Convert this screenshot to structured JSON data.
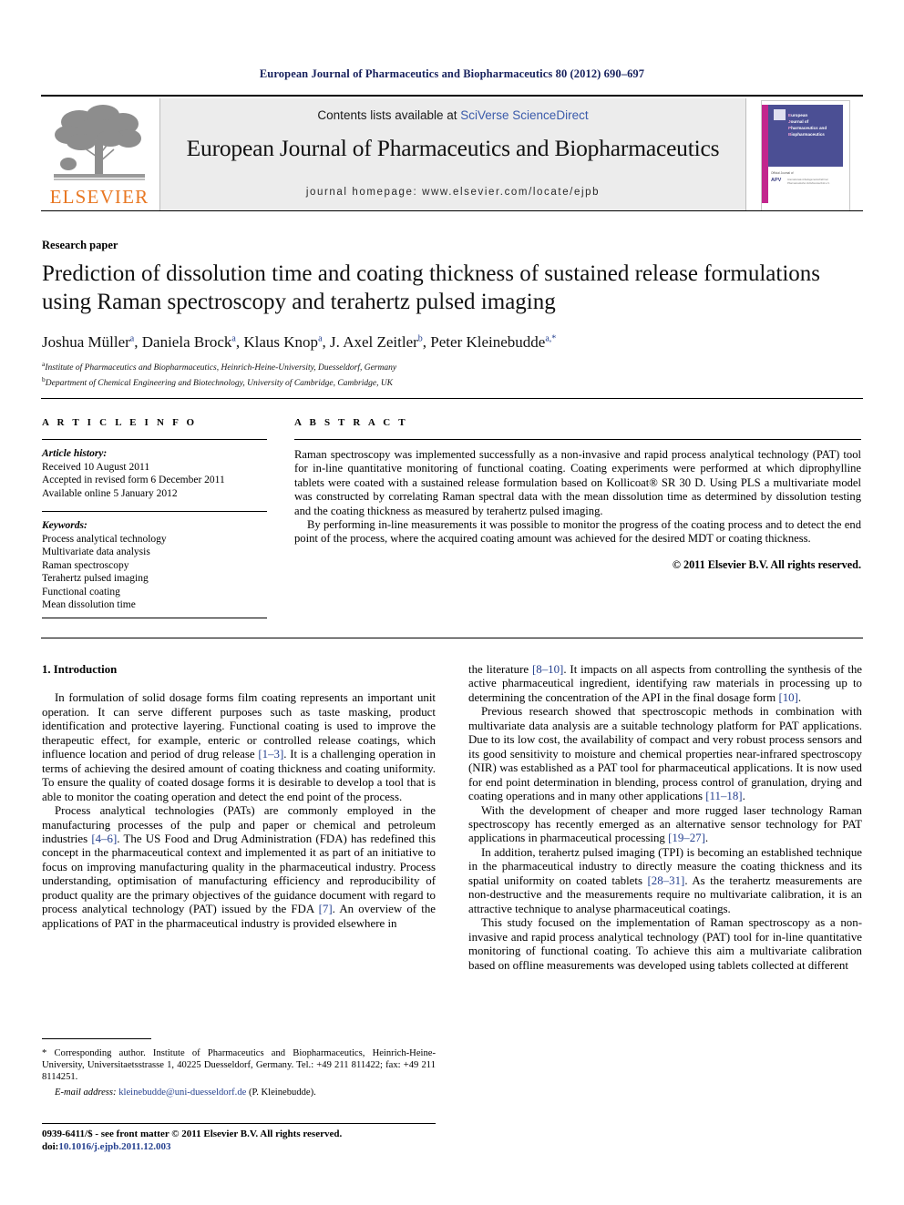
{
  "running_head": "European Journal of Pharmaceutics and Biopharmaceutics 80 (2012) 690–697",
  "masthead": {
    "contents_prefix": "Contents lists available at ",
    "sciencedirect": "SciVerse ScienceDirect",
    "journal_title": "European Journal of Pharmaceutics and Biopharmaceutics",
    "homepage": "journal homepage: www.elsevier.com/locate/ejpb",
    "publisher_word": "ELSEVIER",
    "cover": {
      "line1": "uropean",
      "line2": "ournal of",
      "line3": "harmaceutics and",
      "line4": "iopharmaceutics",
      "cap1": "E",
      "cap2": "J",
      "cap3": "P",
      "cap4": "B",
      "footer_small": "Official Journal of",
      "footer_brand": "APV",
      "footer_tagline": "Internationale Arbeitsgemeinschaft fuer Pharmazeutische Verfahrenstechnik e.V."
    },
    "colors": {
      "elsevier_orange": "#e87722",
      "link_blue": "#3b5bab",
      "banner_grey": "#ececec",
      "cover_navy": "#4b4f94",
      "cover_magenta": "#c2268d"
    }
  },
  "article": {
    "type": "Research paper",
    "title": "Prediction of dissolution time and coating thickness of sustained release formulations using Raman spectroscopy and terahertz pulsed imaging",
    "authors_html": "Joshua Müller<sup>a</sup>, Daniela Brock<sup>a</sup>, Klaus Knop<sup>a</sup>, J. Axel Zeitler<sup>b</sup>, Peter Kleinebudde<sup>a,*</sup>",
    "affiliation_a": "Institute of Pharmaceutics and Biopharmaceutics, Heinrich-Heine-University, Duesseldorf, Germany",
    "affiliation_b": "Department of Chemical Engineering and Biotechnology, University of Cambridge, Cambridge, UK",
    "affiliation_a_marker": "a",
    "affiliation_b_marker": "b"
  },
  "article_info": {
    "label": "A R T I C L E    I N F O",
    "history_head": "Article history:",
    "history": [
      "Received 10 August 2011",
      "Accepted in revised form 6 December 2011",
      "Available online 5 January 2012"
    ],
    "keywords_head": "Keywords:",
    "keywords": [
      "Process analytical technology",
      "Multivariate data analysis",
      "Raman spectroscopy",
      "Terahertz pulsed imaging",
      "Functional coating",
      "Mean dissolution time"
    ]
  },
  "abstract": {
    "label": "A B S T R A C T",
    "paragraph1": "Raman spectroscopy was implemented successfully as a non-invasive and rapid process analytical technology (PAT) tool for in-line quantitative monitoring of functional coating. Coating experiments were performed at which diprophylline tablets were coated with a sustained release formulation based on Kollicoat® SR 30 D. Using PLS a multivariate model was constructed by correlating Raman spectral data with the mean dissolution time as determined by dissolution testing and the coating thickness as measured by terahertz pulsed imaging.",
    "paragraph2": "By performing in-line measurements it was possible to monitor the progress of the coating process and to detect the end point of the process, where the acquired coating amount was achieved for the desired MDT or coating thickness.",
    "copyright": "© 2011 Elsevier B.V. All rights reserved."
  },
  "body": {
    "section_heading": "1. Introduction",
    "left_col": [
      {
        "indent": true,
        "parts": [
          {
            "t": "In formulation of solid dosage forms film coating represents an important unit operation. It can serve different purposes such as taste masking, product identification and protective layering. Functional coating is used to improve the therapeutic effect, for example, enteric or controlled release coatings, which influence location and period of drug release "
          },
          {
            "t": "[1–3]",
            "ref": true
          },
          {
            "t": ". It is a challenging operation in terms of achieving the desired amount of coating thickness and coating uniformity. To ensure the quality of coated dosage forms it is desirable to develop a tool that is able to monitor the coating operation and detect the end point of the process."
          }
        ]
      },
      {
        "indent": true,
        "parts": [
          {
            "t": "Process analytical technologies (PATs) are commonly employed in the manufacturing processes of the pulp and paper or chemical and petroleum industries "
          },
          {
            "t": "[4–6]",
            "ref": true
          },
          {
            "t": ". The US Food and Drug Administration (FDA) has redefined this concept in the pharmaceutical context and implemented it as part of an initiative to focus on improving manufacturing quality in the pharmaceutical industry. Process understanding, optimisation of manufacturing efficiency and reproducibility of product quality are the primary objectives of the guidance document with regard to process analytical technology (PAT) issued by the FDA "
          },
          {
            "t": "[7]",
            "ref": true
          },
          {
            "t": ". An overview of the applications of PAT in the pharmaceutical industry is provided elsewhere in"
          }
        ]
      }
    ],
    "right_col": [
      {
        "indent": false,
        "parts": [
          {
            "t": "the literature "
          },
          {
            "t": "[8–10]",
            "ref": true
          },
          {
            "t": ". It impacts on all aspects from controlling the synthesis of the active pharmaceutical ingredient, identifying raw materials in processing up to determining the concentration of the API in the final dosage form "
          },
          {
            "t": "[10]",
            "ref": true
          },
          {
            "t": "."
          }
        ]
      },
      {
        "indent": true,
        "parts": [
          {
            "t": "Previous research showed that spectroscopic methods in combination with multivariate data analysis are a suitable technology platform for PAT applications. Due to its low cost, the availability of compact and very robust process sensors and its good sensitivity to moisture and chemical properties near-infrared spectroscopy (NIR) was established as a PAT tool for pharmaceutical applications. It is now used for end point determination in blending, process control of granulation, drying and coating operations and in many other applications "
          },
          {
            "t": "[11–18]",
            "ref": true
          },
          {
            "t": "."
          }
        ]
      },
      {
        "indent": true,
        "parts": [
          {
            "t": "With the development of cheaper and more rugged laser technology Raman spectroscopy has recently emerged as an alternative sensor technology for PAT applications in pharmaceutical processing "
          },
          {
            "t": "[19–27]",
            "ref": true
          },
          {
            "t": "."
          }
        ]
      },
      {
        "indent": true,
        "parts": [
          {
            "t": "In addition, terahertz pulsed imaging (TPI) is becoming an established technique in the pharmaceutical industry to directly measure the coating thickness and its spatial uniformity on coated tablets "
          },
          {
            "t": "[28–31]",
            "ref": true
          },
          {
            "t": ". As the terahertz measurements are non-destructive and the measurements require no multivariate calibration, it is an attractive technique to analyse pharmaceutical coatings."
          }
        ]
      },
      {
        "indent": true,
        "parts": [
          {
            "t": "This study focused on the implementation of Raman spectroscopy as a non-invasive and rapid process analytical technology (PAT) tool for in-line quantitative monitoring of functional coating. To achieve this aim a multivariate calibration based on offline measurements was developed using tablets collected at different"
          }
        ]
      }
    ]
  },
  "footnote": {
    "corresponding": "* Corresponding author. Institute of Pharmaceutics and Biopharmaceutics, Heinrich-Heine-University, Universitaetsstrasse 1, 40225 Duesseldorf, Germany. Tel.: +49 211 811422; fax: +49 211 8114251.",
    "email_label": "E-mail address:",
    "email_address": "kleinebudde@uni-duesseldorf.de",
    "email_suffix": "(P. Kleinebudde)."
  },
  "footer": {
    "issn_line": "0939-6411/$ - see front matter © 2011 Elsevier B.V. All rights reserved.",
    "doi_label": "doi:",
    "doi_value": "10.1016/j.ejpb.2011.12.003"
  }
}
